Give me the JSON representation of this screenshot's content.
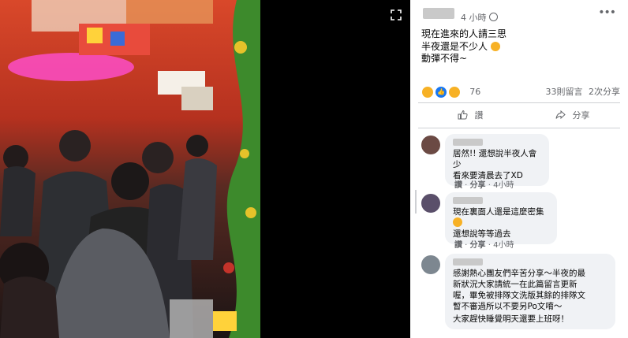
{
  "post": {
    "time": "4 小時",
    "text_line1": "現在進來的人請三思",
    "text_line2": "半夜還是不少人",
    "text_line3": "動彈不得~",
    "reaction_count": "76",
    "comments_count": "33則留言",
    "shares_count": "2次分享",
    "like_button": "讚",
    "share_button": "分享"
  },
  "comments": [
    {
      "line1": "居然!! 還想說半夜人會少",
      "line2": "看來要清晨去了XD",
      "like": "讚",
      "share": "分享",
      "time": "4小時"
    },
    {
      "line1": "現在裏面人還是這麼密集",
      "line2": "還想說等等過去",
      "like": "讚",
      "share": "分享",
      "time": "4小時"
    },
    {
      "line1": "感謝熱心團友們辛苦分享～半夜的最",
      "line2": "新狀況大家請統一在此篇留言更新",
      "line3": "喔，畢免被排隊文洗版其餘的排隊文",
      "line4": "暫不審過所以不要另Po文唷～",
      "line5": "大家趕快睡覺明天還要上班呀！"
    }
  ],
  "colors": {
    "panel_bg": "#ffffff",
    "bubble_bg": "#f0f2f5",
    "secondary_text": "#65676b",
    "reaction_wow": "#f7b125",
    "reaction_like": "#1877f2",
    "reaction_haha": "#f7b125"
  },
  "icons": [
    "expand-icon",
    "globe-icon",
    "more-icon",
    "like-icon",
    "share-icon",
    "wow-reaction-icon",
    "like-reaction-icon",
    "haha-reaction-icon"
  ]
}
